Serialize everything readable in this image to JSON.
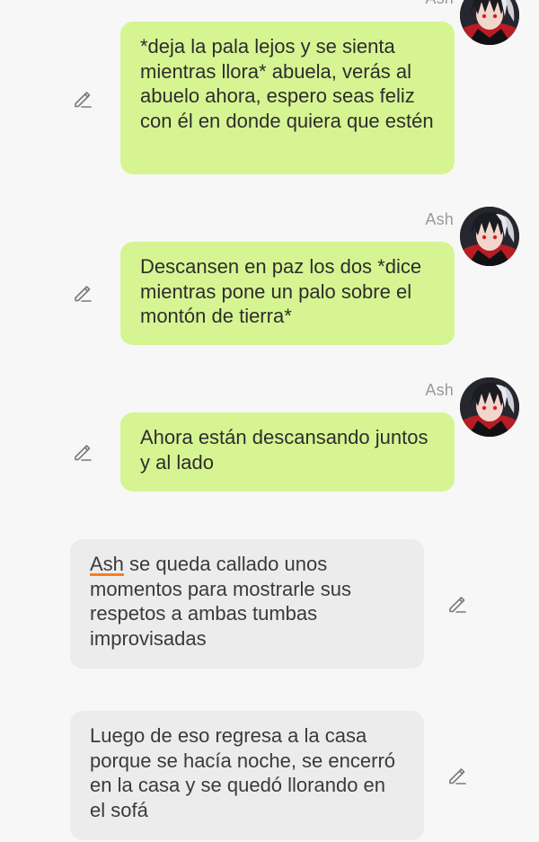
{
  "messages": [
    {
      "type": "user",
      "author": "Ash",
      "text": "*deja la pala lejos y se sienta mientras llora* abuela, verás al abuelo ahora, espero seas feliz con él en donde quiera que estén"
    },
    {
      "type": "user",
      "author": "Ash",
      "text": "Descansen en paz los dos *dice mientras pone un palo sobre el montón de tierra*"
    },
    {
      "type": "user",
      "author": "Ash",
      "text": "Ahora están descansando juntos y al lado"
    },
    {
      "type": "narration",
      "mention": "Ash",
      "text": " se queda callado unos momentos para mostrarle sus respetos a ambas tumbas improvisadas"
    },
    {
      "type": "narration",
      "text": "Luego de eso regresa a la casa porque se hacía noche, se encerró en la casa y se quedó llorando en el sofá"
    }
  ],
  "icons": {
    "edit": "pencil-edit-icon",
    "avatar": "avatar-image"
  },
  "colors": {
    "user_bubble": "#d6f592",
    "narration_bubble": "#ececec",
    "background": "#f7f7f7",
    "name_text": "#9a9a9a",
    "mention_underline": "#ff7a1a"
  }
}
